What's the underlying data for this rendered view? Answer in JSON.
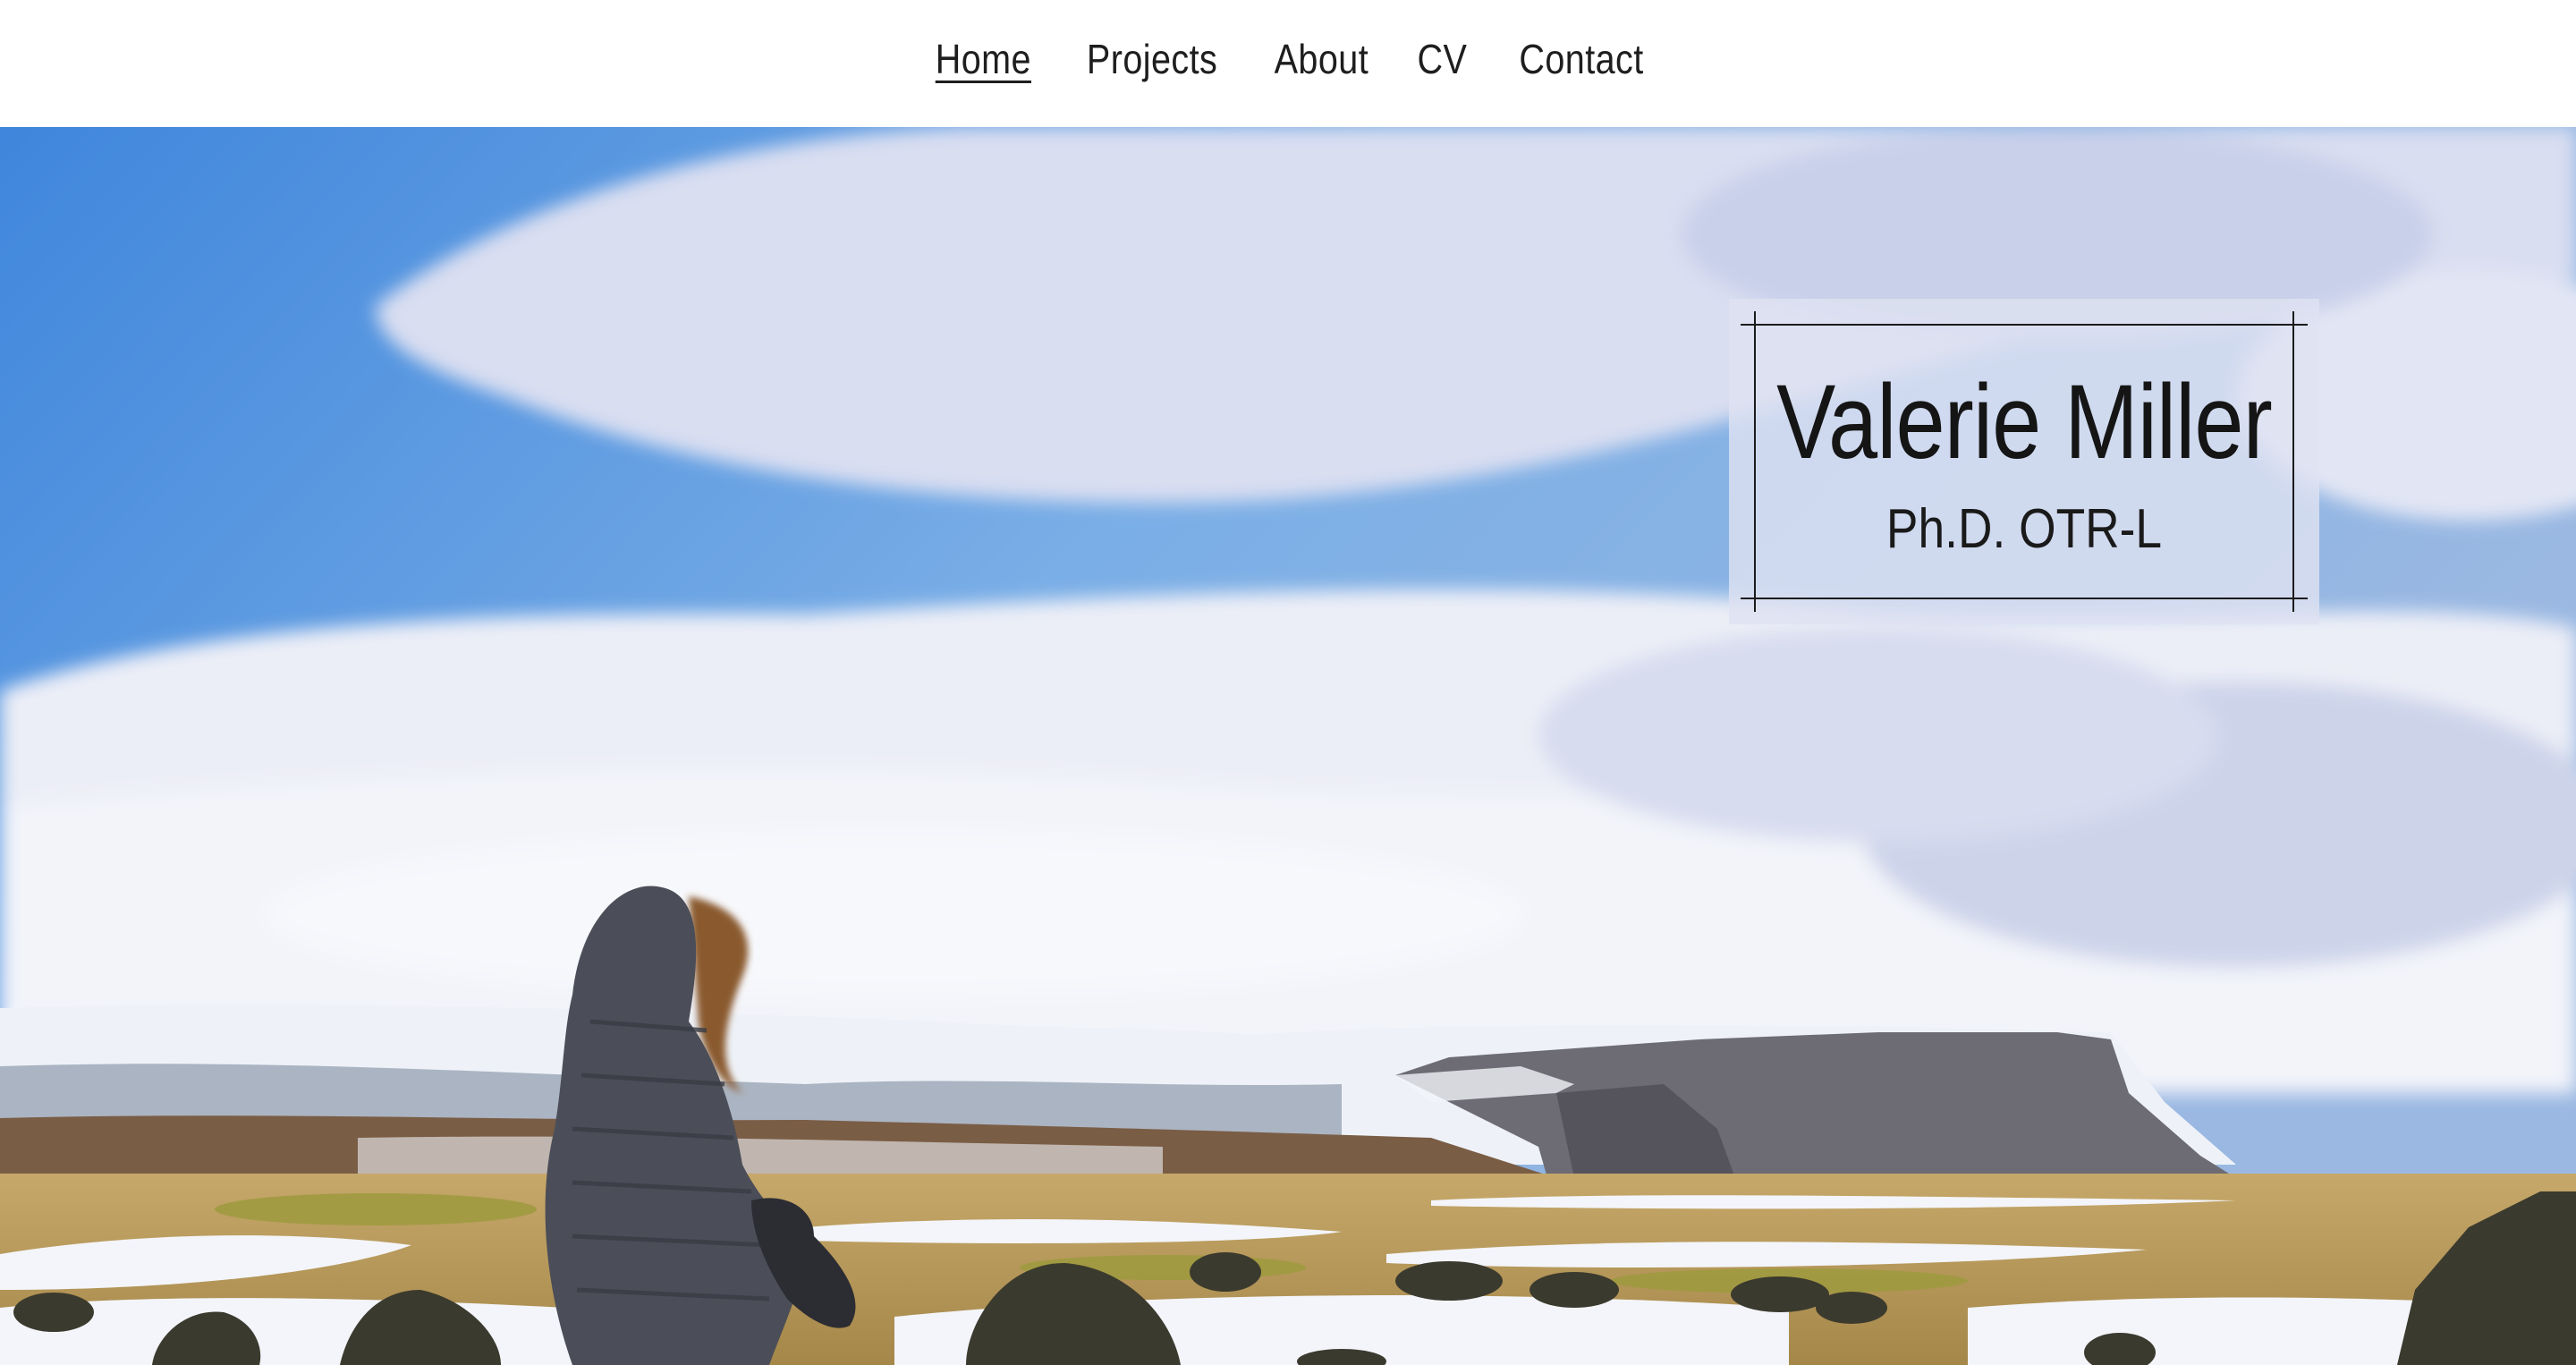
{
  "nav": {
    "items": [
      {
        "label": "Home",
        "active": true
      },
      {
        "label": "Projects",
        "active": false
      },
      {
        "label": "About",
        "active": false
      },
      {
        "label": "CV",
        "active": false
      },
      {
        "label": "Contact",
        "active": false
      }
    ]
  },
  "hero": {
    "name": "Valerie Miller",
    "credentials": "Ph.D. OTR-L",
    "colors": {
      "sky": "#5f9ae0",
      "cloud": "#dfe3f3",
      "snow": "#f2f5fb",
      "cliff": "#6b6a72",
      "grass": "#b59a55",
      "jacket": "#4a4d57",
      "hair": "#8a5a2e"
    }
  }
}
